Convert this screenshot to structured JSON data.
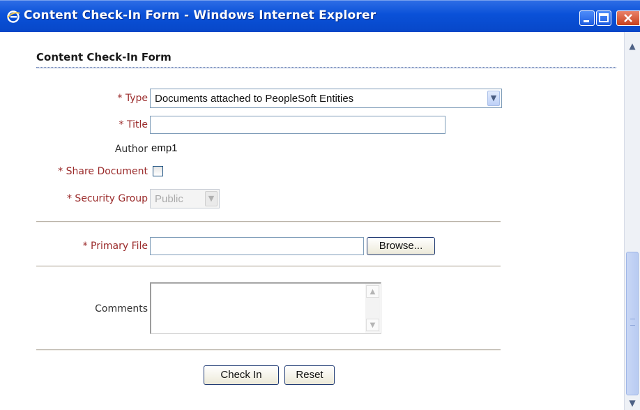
{
  "window": {
    "title": "Content Check-In Form - Windows Internet Explorer",
    "icons": [
      "ie-logo-icon",
      "minimize-icon",
      "maximize-icon",
      "close-icon"
    ]
  },
  "form": {
    "title": "Content Check-In Form",
    "type": {
      "label": "* Type",
      "value": "Documents attached to PeopleSoft Entities"
    },
    "title_field": {
      "label": "* Title",
      "value": ""
    },
    "author": {
      "label": "Author",
      "value": "emp1"
    },
    "share_document": {
      "label": "* Share Document",
      "checked": false
    },
    "security_group": {
      "label": "* Security Group",
      "value": "Public",
      "disabled": true
    },
    "primary_file": {
      "label": "* Primary File",
      "value": "",
      "browse_label": "Browse..."
    },
    "comments": {
      "label": "Comments",
      "value": ""
    },
    "buttons": {
      "check_in": "Check In",
      "reset": "Reset"
    }
  },
  "colors": {
    "titlebar": "#0a51d8",
    "required_label": "#9a2a2a",
    "title_rule": "#6f86b8"
  }
}
